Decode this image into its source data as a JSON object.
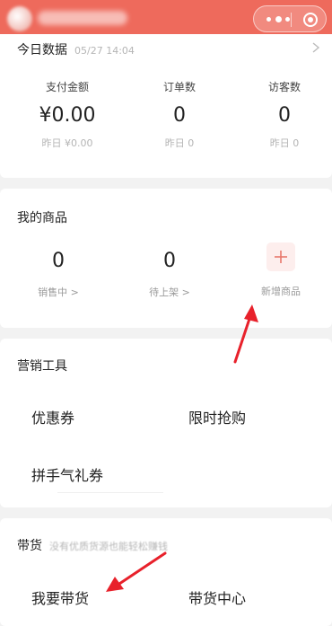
{
  "header": {
    "avatar_icon": "avatar-icon",
    "more_icon": "more-dots-icon",
    "close_icon": "target-icon",
    "accent_color": "#ee6a5c"
  },
  "today": {
    "title": "今日数据",
    "timestamp": "05/27 14:04",
    "stats": [
      {
        "label": "支付金额",
        "value": "¥0.00",
        "yesterday": "昨日 ¥0.00"
      },
      {
        "label": "订单数",
        "value": "0",
        "yesterday": "昨日 0"
      },
      {
        "label": "访客数",
        "value": "0",
        "yesterday": "昨日 0"
      }
    ]
  },
  "products": {
    "title": "我的商品",
    "on_sale": {
      "value": "0",
      "label": "销售中 >"
    },
    "pending": {
      "value": "0",
      "label": "待上架 >"
    },
    "add": {
      "label": "新增商品"
    }
  },
  "marketing": {
    "title": "营销工具",
    "tools": [
      "优惠券",
      "限时抢购",
      "拼手气礼券"
    ]
  },
  "daihuo": {
    "title": "带货",
    "hint": "没有优质货源也能轻松赚钱",
    "actions": [
      "我要带货",
      "带货中心"
    ]
  },
  "annotation_color": "#e8212b"
}
